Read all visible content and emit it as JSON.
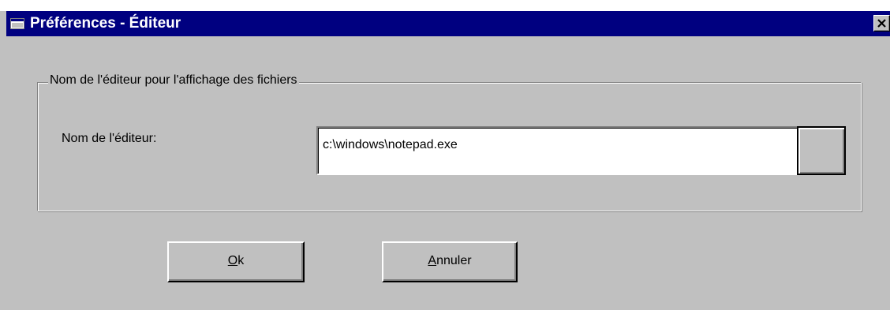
{
  "window": {
    "title": "Préférences - Éditeur"
  },
  "group": {
    "legend": "Nom de l'éditeur pour l'affichage des fichiers"
  },
  "editor": {
    "label": "Nom de l'éditeur:",
    "value": "c:\\windows\\notepad.exe"
  },
  "buttons": {
    "ok": {
      "mnemonic": "O",
      "rest": "k"
    },
    "cancel": {
      "mnemonic": "A",
      "rest": "nnuler"
    }
  },
  "icons": {
    "title": "window-icon",
    "close": "close-icon"
  },
  "colors": {
    "titlebar": "#000080",
    "face": "#c0c0c0"
  }
}
